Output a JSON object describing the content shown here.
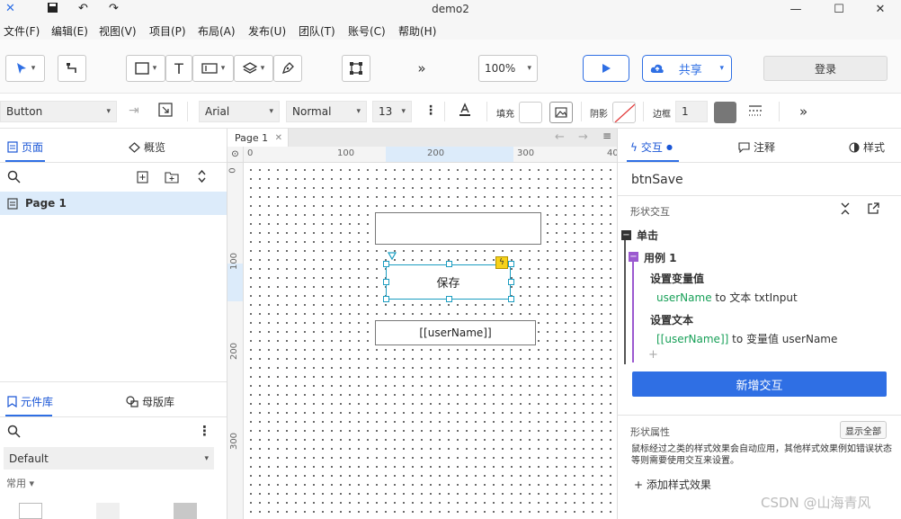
{
  "app": {
    "title": "demo2"
  },
  "menu": [
    "文件(F)",
    "编辑(E)",
    "视图(V)",
    "项目(P)",
    "布局(A)",
    "发布(U)",
    "团队(T)",
    "账号(C)",
    "帮助(H)"
  ],
  "toolbar": {
    "text_tool": "T",
    "more": "»",
    "zoom": "100%",
    "share": "共享",
    "login": "登录"
  },
  "propbar": {
    "widget_type": "Button",
    "font": "Arial",
    "weight": "Normal",
    "size": "13",
    "fill_label": "填充",
    "shadow_label": "阴影",
    "border_label": "边框",
    "border_value": "1",
    "more": "»"
  },
  "left": {
    "pages_tab": "页面",
    "overview_tab": "概览",
    "page_item": "Page 1",
    "library_tab": "元件库",
    "masters_tab": "母版库",
    "library_select": "Default",
    "common_label": "常用"
  },
  "canvas": {
    "tab": "Page 1",
    "hruler_ticks": [
      "0",
      "100",
      "200",
      "300",
      "40"
    ],
    "vruler_ticks": [
      "0",
      "100",
      "200",
      "300"
    ],
    "save_button": "保存",
    "label_username": "[[userName]]"
  },
  "right": {
    "tab_interaction": "交互",
    "tab_notes": "注释",
    "tab_style": "样式",
    "widget_name": "btnSave",
    "shape_interaction": "形状交互",
    "event": "单击",
    "case": "用例 1",
    "action1_title": "设置变量值",
    "action1_var": "userName",
    "action1_rest": " to 文本 txtInput",
    "action2_title": "设置文本",
    "action2_var": "[[userName]]",
    "action2_rest": " to 变量值 userName",
    "add_interaction": "新增交互",
    "shape_props": "形状属性",
    "show_all": "显示全部",
    "shape_desc": "鼠标经过之类的样式效果会自动应用，其他样式效果例如错误状态等则需要使用交互来设置。",
    "add_style": "+ 添加样式效果"
  },
  "watermark": "CSDN @山海青风",
  "colors": {
    "accent": "#2f6fe4",
    "selection": "#1b9dc1",
    "green": "#18a058"
  }
}
